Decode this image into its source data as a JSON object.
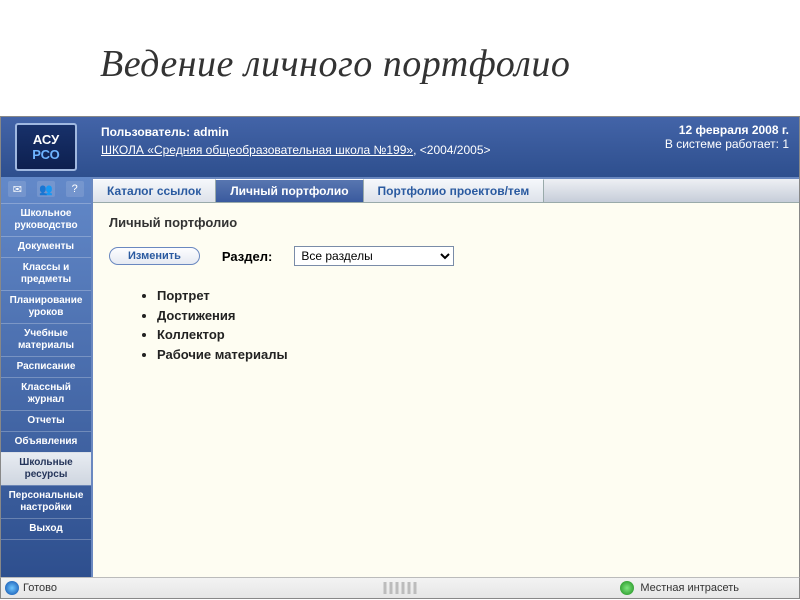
{
  "slide": {
    "title": "Ведение личного портфолио"
  },
  "logo": {
    "line1": "АСУ",
    "line2": "РСО"
  },
  "header": {
    "user_label": "Пользователь:",
    "user_value": "admin",
    "school_link": "ШКОЛА «Средняя общеобразовательная школа №199»",
    "year": ", <2004/2005>",
    "date": "12 февраля 2008 г.",
    "online_label": "В системе работает:",
    "online_count": "1"
  },
  "sidebar": {
    "icons": [
      "✉",
      "👥",
      "?"
    ],
    "items": [
      "Школьное руководство",
      "Документы",
      "Классы и предметы",
      "Планирование уроков",
      "Учебные материалы",
      "Расписание",
      "Классный журнал",
      "Отчеты",
      "Объявления",
      "Школьные ресурсы",
      "Персональные настройки",
      "Выход"
    ],
    "selected_index": 9
  },
  "tabs": {
    "items": [
      {
        "label": "Каталог ссылок"
      },
      {
        "label": "Личный портфолио"
      },
      {
        "label": "Портфолио проектов/тем"
      }
    ],
    "active_index": 1
  },
  "content": {
    "page_title": "Личный портфолио",
    "edit_button": "Изменить",
    "section_label": "Раздел:",
    "section_value": "Все разделы",
    "bullets": [
      "Портрет",
      "Достижения",
      "Коллектор",
      "Рабочие материалы"
    ]
  },
  "statusbar": {
    "ready": "Готово",
    "zone": "Местная интрасеть"
  }
}
